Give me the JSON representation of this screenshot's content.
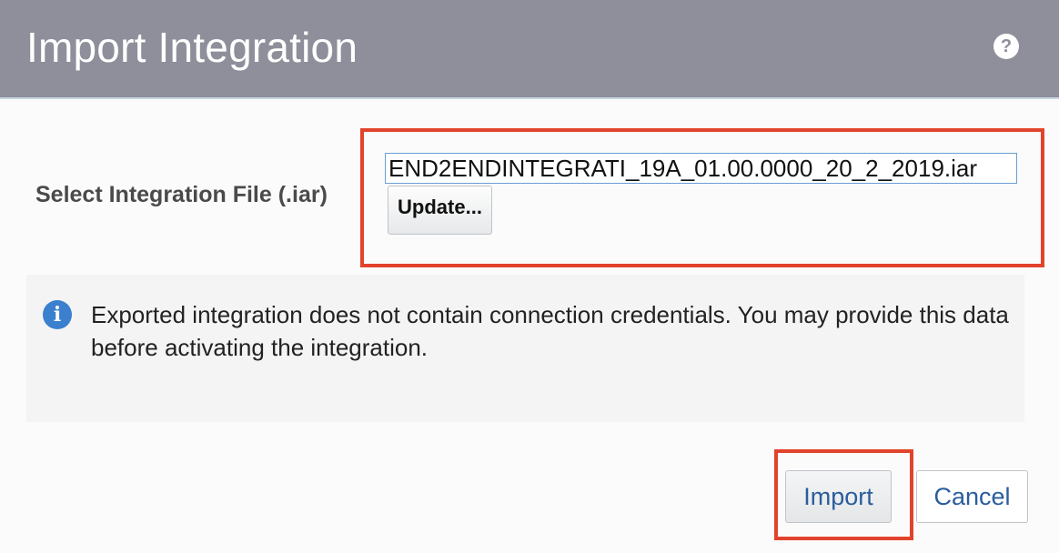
{
  "dialog": {
    "title": "Import Integration",
    "help_icon": "help-icon",
    "help_glyph": "?"
  },
  "form": {
    "file_label": "Select Integration File (.iar)",
    "file_value": "END2ENDINTEGRATI_19A_01.00.0000_20_2_2019.iar",
    "update_label": "Update..."
  },
  "info": {
    "icon": "info-icon",
    "icon_glyph": "i",
    "message": "Exported integration does not contain connection credentials. You may provide this data before activating the integration."
  },
  "actions": {
    "import_label": "Import",
    "cancel_label": "Cancel"
  },
  "colors": {
    "title_bar": "#8e8f9a",
    "highlight": "#e2432d",
    "link_text": "#2a5d9c",
    "info_icon": "#3b7fcf"
  }
}
